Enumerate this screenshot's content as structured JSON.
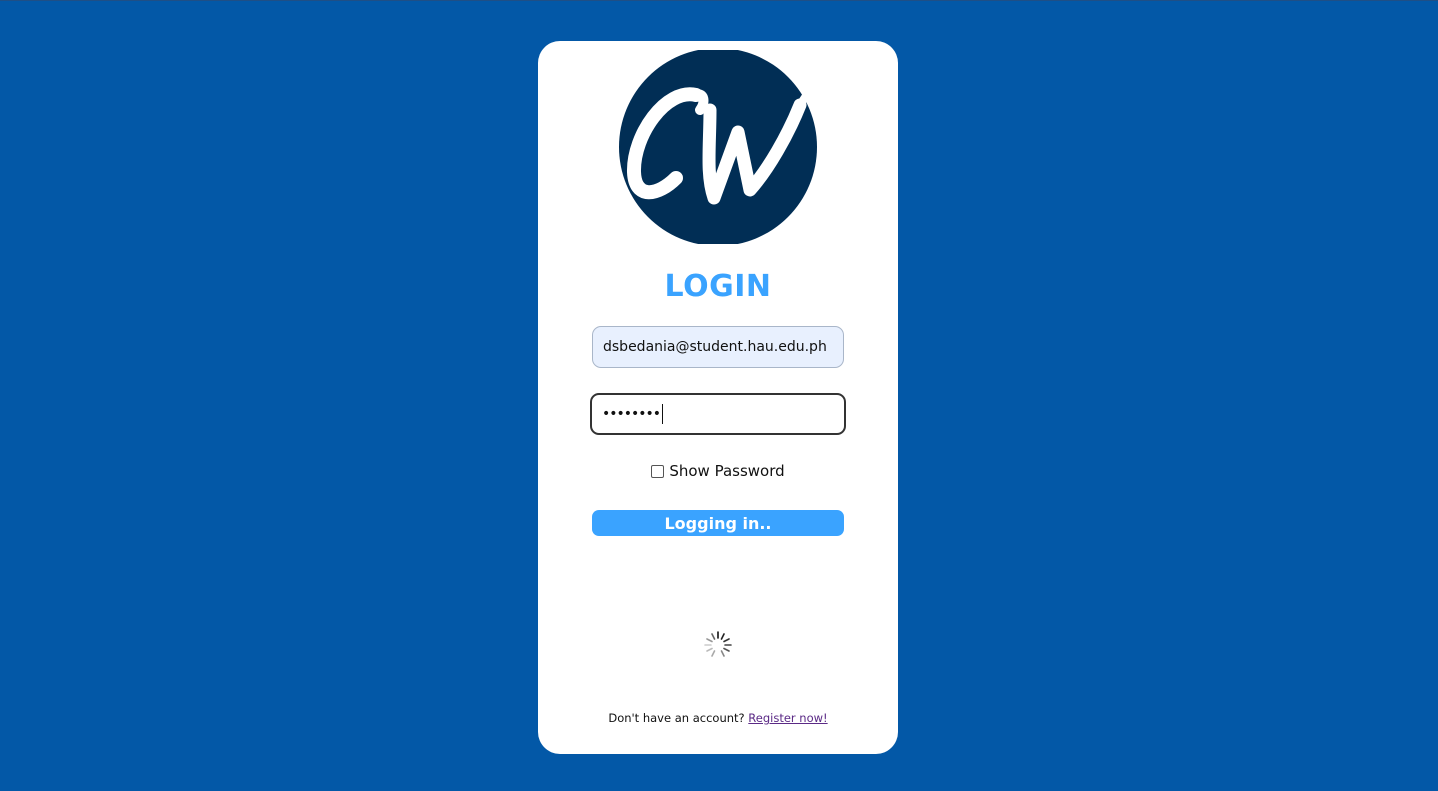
{
  "logo": {
    "text": "CW",
    "circle_color": "#012e55"
  },
  "login": {
    "title": "LOGIN",
    "email_value": "dsbedania@student.hau.edu.ph",
    "password_masked": "••••••••",
    "show_password_label": "Show Password",
    "button_label": "Logging in..",
    "spinner_icon": "loading-spinner-icon"
  },
  "footer": {
    "prompt": "Don't have an account?",
    "register_link": "Register now!"
  },
  "colors": {
    "background": "#0358a7",
    "accent": "#3aa3ff",
    "card": "#ffffff"
  }
}
